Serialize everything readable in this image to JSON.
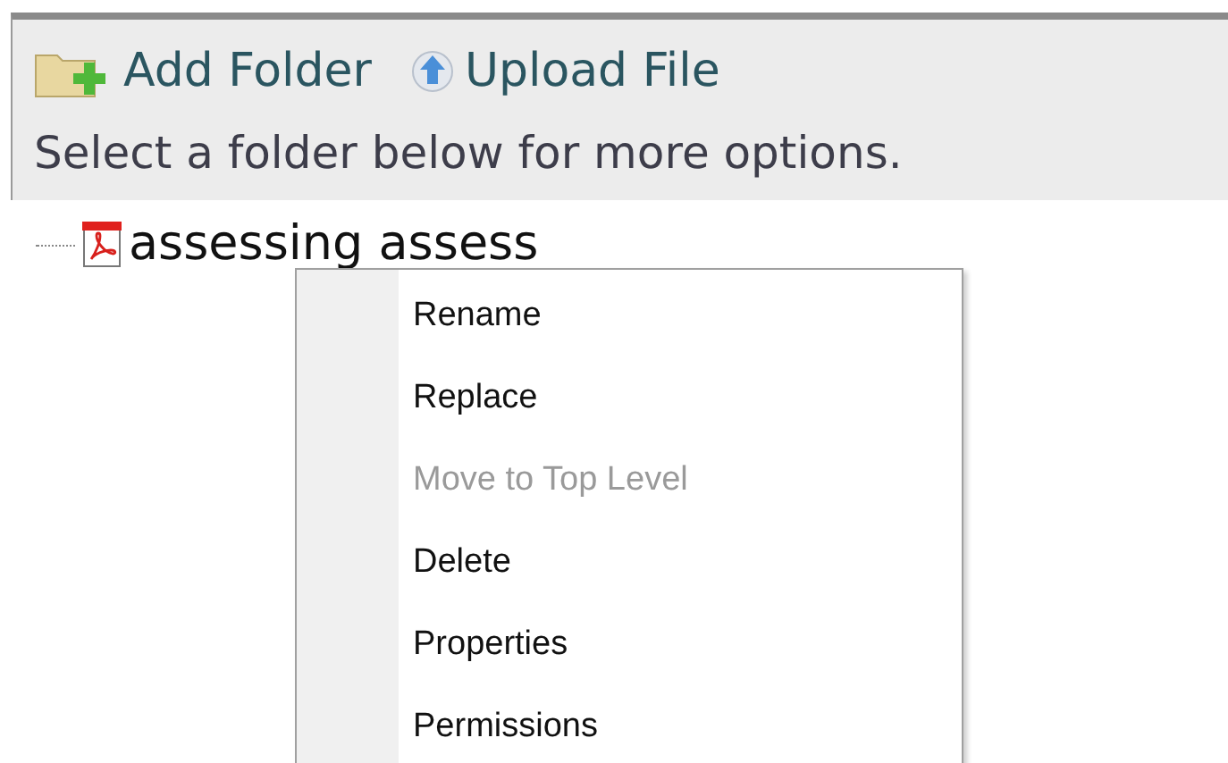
{
  "toolbar": {
    "actions": [
      {
        "kind": "add-folder",
        "label": "Add Folder"
      },
      {
        "kind": "upload",
        "label": "Upload File"
      }
    ],
    "hint": "Select a folder below for more options."
  },
  "tree": {
    "items": [
      {
        "kind": "pdf",
        "label": "assessing assess"
      }
    ]
  },
  "context_menu": {
    "items": [
      {
        "label": "Rename",
        "disabled": false
      },
      {
        "label": "Replace",
        "disabled": false
      },
      {
        "label": "Move to Top Level",
        "disabled": true
      },
      {
        "label": "Delete",
        "disabled": false
      },
      {
        "label": "Properties",
        "disabled": false
      },
      {
        "label": "Permissions",
        "disabled": false
      }
    ]
  }
}
